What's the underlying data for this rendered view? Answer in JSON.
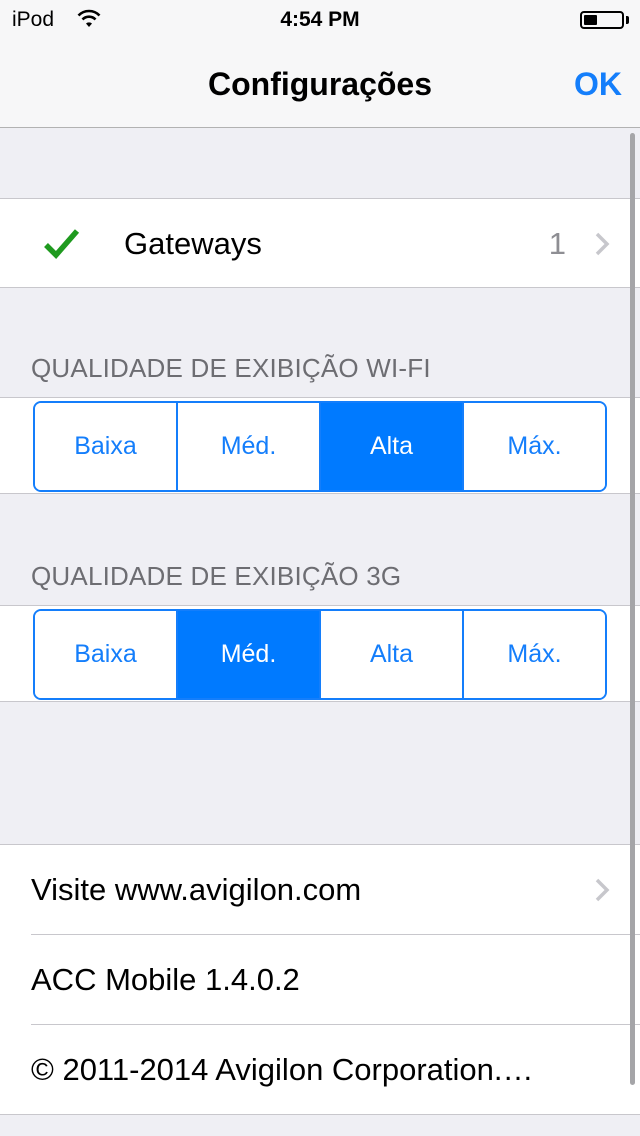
{
  "status_bar": {
    "carrier": "iPod",
    "wifi_icon": "wifi-icon",
    "time": "4:54 PM",
    "battery_icon": "battery-icon",
    "battery_level_percent": 35
  },
  "nav": {
    "title": "Configurações",
    "ok_label": "OK"
  },
  "gateways": {
    "icon": "checkmark-icon",
    "label": "Gateways",
    "count": "1",
    "accessory": "chevron-right-icon"
  },
  "wifi_quality": {
    "header": "QUALIDADE DE EXIBIÇÃO WI-FI",
    "options": [
      "Baixa",
      "Méd.",
      "Alta",
      "Máx."
    ],
    "selected": "Alta"
  },
  "cellular_quality": {
    "header": "QUALIDADE DE EXIBIÇÃO 3G",
    "options": [
      "Baixa",
      "Méd.",
      "Alta",
      "Máx."
    ],
    "selected": "Méd."
  },
  "info": {
    "items": [
      {
        "label": "Visite www.avigilon.com",
        "accessory": "chevron-right-icon"
      },
      {
        "label": "ACC Mobile 1.4.0.2"
      },
      {
        "label": "© 2011-2014 Avigilon Corporation.…"
      }
    ]
  },
  "colors": {
    "accent": "#147efb",
    "selected_segment": "#007aff",
    "check_green": "#1f9a1f",
    "background": "#efeff4"
  }
}
